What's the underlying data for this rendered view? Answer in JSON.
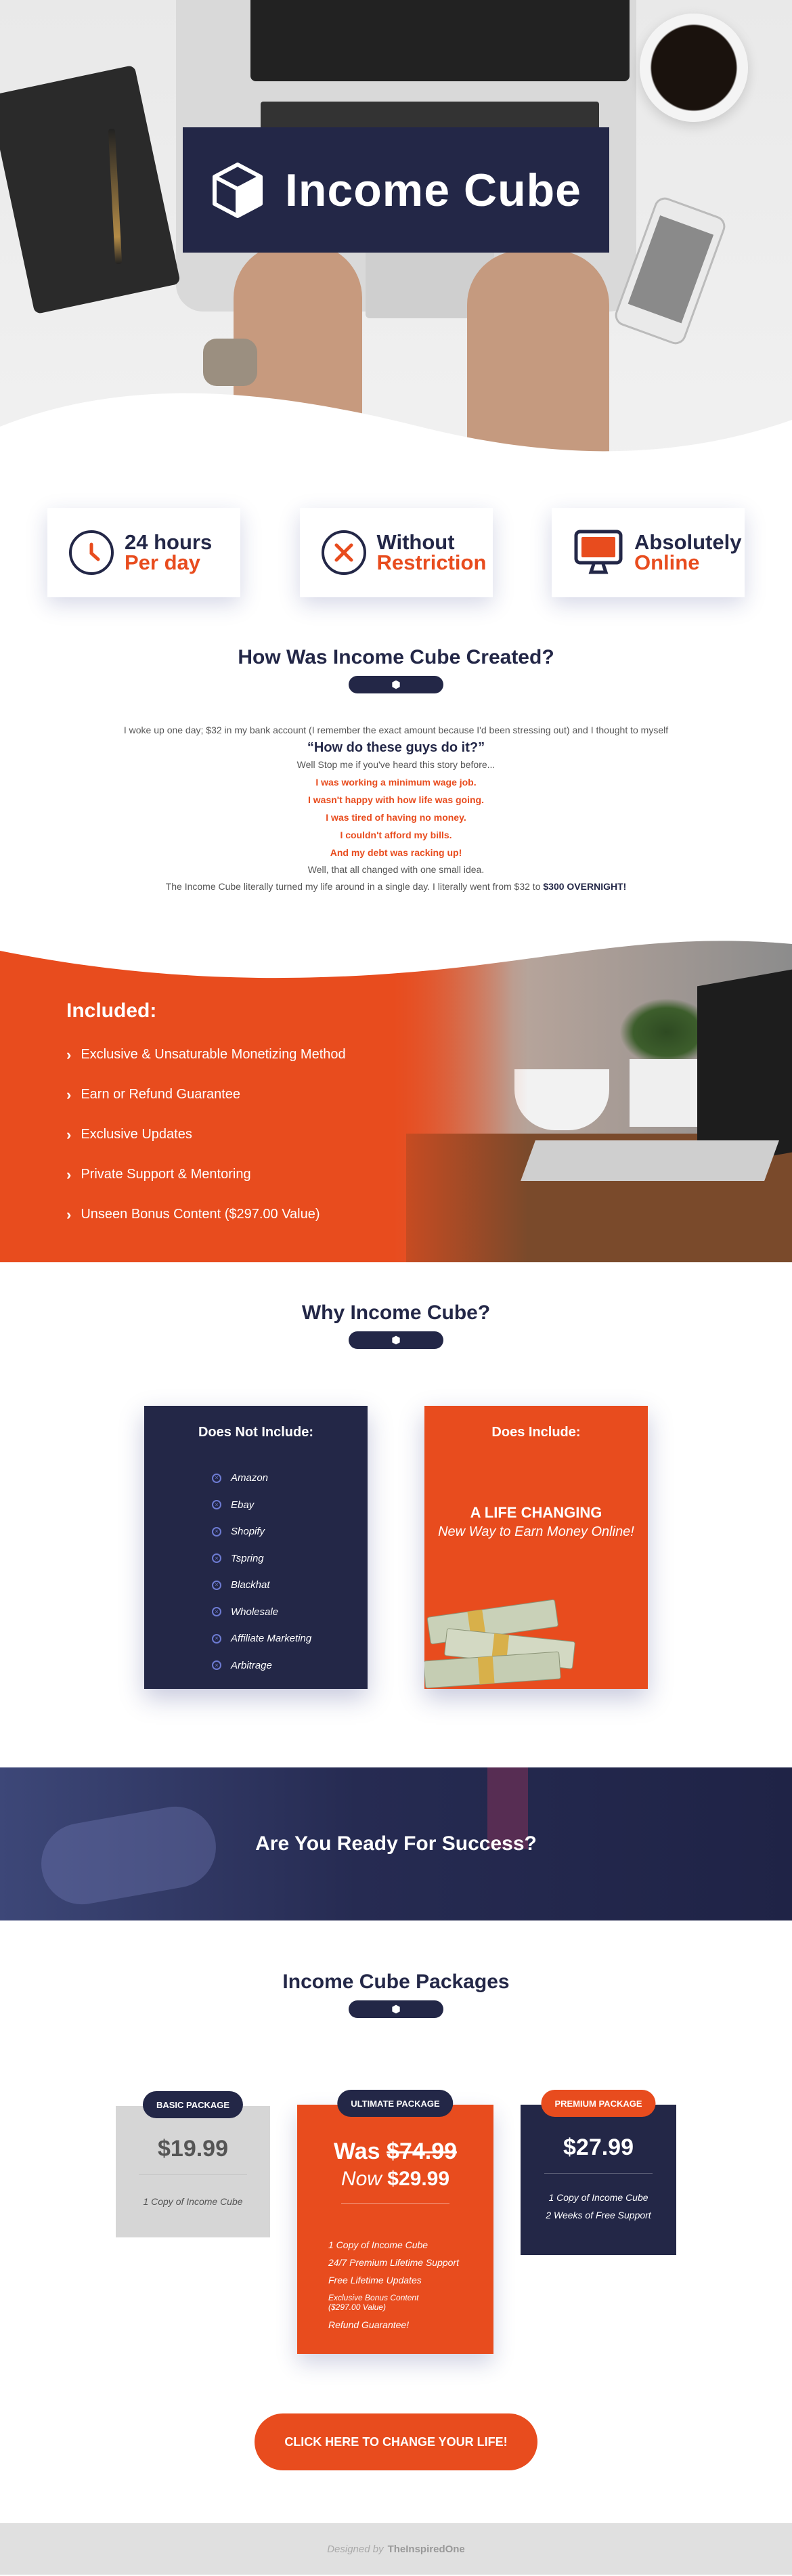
{
  "brand": {
    "name": "Income Cube",
    "accent": "#e84c1e",
    "navy": "#232747"
  },
  "features": [
    {
      "line1": "24 hours",
      "line2": "Per day",
      "icon": "clock-icon"
    },
    {
      "line1": "Without",
      "line2": "Restriction",
      "icon": "x-circle-icon"
    },
    {
      "line1": "Absolutely",
      "line2": "Online",
      "icon": "monitor-icon"
    }
  ],
  "story": {
    "title": "How Was Income Cube Created?",
    "p1": "I woke up one day; $32 in my bank account (I remember the exact amount because I'd been stressing out) and I thought to myself",
    "quote": "“How do these guys do it?”",
    "p2": "Well Stop me if you've heard this story before...",
    "red": [
      "I was working a minimum wage job.",
      "I wasn't happy with how life was going.",
      "I was tired of having no money.",
      "I couldn't afford my bills.",
      "And my debt was racking up!"
    ],
    "p3": "Well, that all changed with one small idea.",
    "p4_prefix": "The Income Cube literally turned my life around in a single day. I literally went from $32 to ",
    "p4_bold": "$300 OVERNIGHT!"
  },
  "included": {
    "title": "Included:",
    "items": [
      "Exclusive & Unsaturable Monetizing Method",
      "Earn or Refund Guarantee",
      "Exclusive Updates",
      "Private Support & Mentoring",
      "Unseen Bonus Content ($297.00 Value)"
    ]
  },
  "why": {
    "title": "Why Income Cube?",
    "not_include_title": "Does Not Include:",
    "not_include": [
      "Amazon",
      "Ebay",
      "Shopify",
      "Tspring",
      "Blackhat",
      "Wholesale",
      "Affiliate Marketing",
      "Arbitrage"
    ],
    "include_title": "Does Include:",
    "include_headline": "A LIFE CHANGING",
    "include_sub": "New Way to Earn Money Online!"
  },
  "banner": {
    "text": "Are You Ready For Success?"
  },
  "packages": {
    "title": "Income Cube Packages",
    "basic": {
      "badge": "BASIC PACKAGE",
      "price": "$19.99",
      "features": [
        "1 Copy of Income Cube"
      ]
    },
    "ultimate": {
      "badge": "ULTIMATE PACKAGE",
      "was_label": "Was",
      "was_price": "$74.99",
      "now_label": "Now",
      "now_price": "$29.99",
      "features": [
        "1 Copy of Income Cube",
        "24/7 Premium Lifetime Support",
        "Free Lifetime Updates",
        "Exclusive Bonus Content ($297.00 Value)",
        "Refund Guarantee!"
      ]
    },
    "premium": {
      "badge": "PREMIUM PACKAGE",
      "price": "$27.99",
      "features": [
        "1 Copy of Income Cube",
        "2 Weeks of Free Support"
      ]
    }
  },
  "cta": {
    "label": "CLICK HERE TO CHANGE YOUR LIFE!"
  },
  "footer": {
    "prefix": "Designed by",
    "name": "TheInspiredOne"
  }
}
